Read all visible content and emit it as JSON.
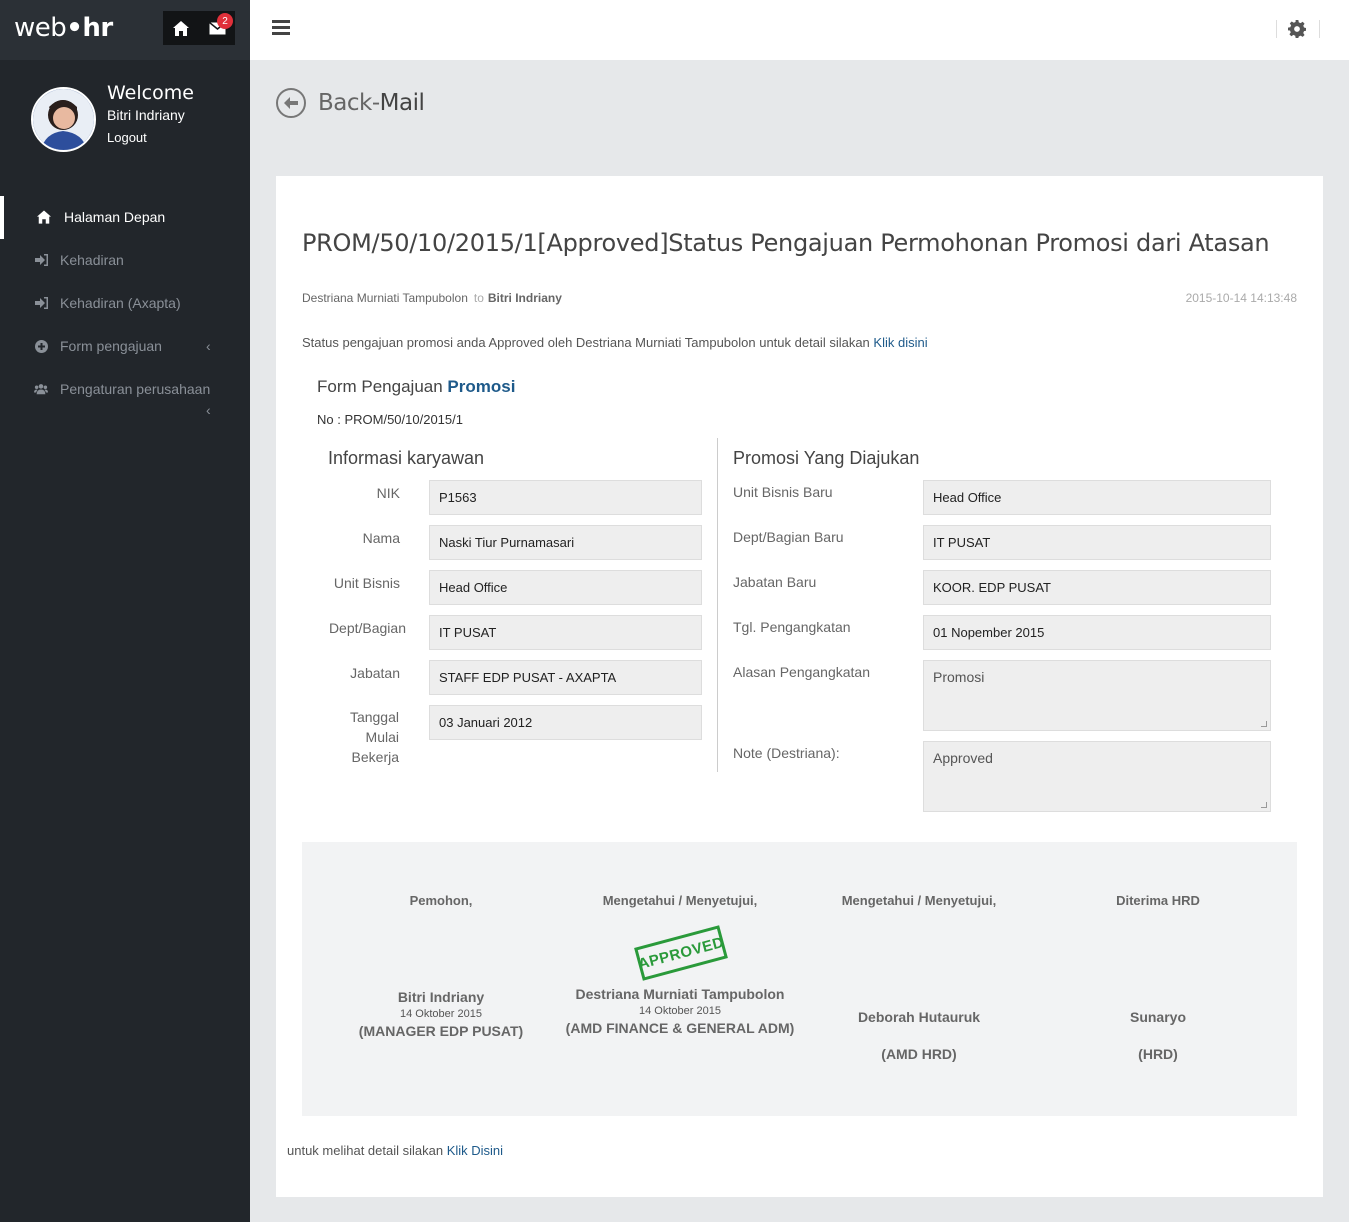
{
  "app": {
    "logo_a": "web",
    "logo_dot": "•",
    "logo_b": "hr",
    "mail_count": "2"
  },
  "profile": {
    "welcome": "Welcome",
    "name": "Bitri Indriany",
    "logout": "Logout"
  },
  "menu": {
    "items": [
      {
        "label": "Halaman Depan",
        "icon": "home-icon"
      },
      {
        "label": "Kehadiran",
        "icon": "sign-in-icon"
      },
      {
        "label": "Kehadiran (Axapta)",
        "icon": "sign-in-icon"
      },
      {
        "label": "Form pengajuan",
        "icon": "plus-circle-icon"
      },
      {
        "label": "Pengaturan perusahaan",
        "icon": "users-icon"
      }
    ]
  },
  "header": {
    "back": "Back-",
    "section": "Mail"
  },
  "mail": {
    "subject": "PROM/50/10/2015/1[Approved]Status Pengajuan Permohonan Promosi dari Atasan",
    "from": "Destriana Murniati Tampubolon",
    "to_label": "to",
    "to": "Bitri Indriany",
    "date": "2015-10-14 14:13:48",
    "message": "Status pengajuan promosi anda Approved oleh Destriana Murniati Tampubolon untuk detail silakan ",
    "message_link": "Klik disini",
    "footer": "untuk melihat detail silakan ",
    "footer_link": "Klik Disini"
  },
  "form": {
    "title": "Form Pengajuan ",
    "title_bold": "Promosi",
    "number": "No : PROM/50/10/2015/1",
    "left_title": "Informasi karyawan",
    "right_title": "Promosi Yang Diajukan",
    "left_fields": [
      {
        "label": "NIK",
        "value": "P1563"
      },
      {
        "label": "Nama",
        "value": "Naski Tiur Purnamasari"
      },
      {
        "label": "Unit Bisnis",
        "value": "Head Office"
      },
      {
        "label": "Dept/Bagian",
        "value": "IT PUSAT"
      },
      {
        "label": "Jabatan",
        "value": "STAFF EDP PUSAT - AXAPTA"
      },
      {
        "label": "Tanggal Mulai Bekerja",
        "value": "03 Januari 2012"
      }
    ],
    "tanggal_lines": [
      "Tanggal",
      "Mulai",
      "Bekerja"
    ],
    "right_fields": [
      {
        "label": "Unit Bisnis Baru",
        "value": "Head Office"
      },
      {
        "label": "Dept/Bagian Baru",
        "value": "IT PUSAT"
      },
      {
        "label": "Jabatan Baru",
        "value": "KOOR. EDP PUSAT"
      },
      {
        "label": "Tgl. Pengangkatan",
        "value": "01 Nopember 2015"
      },
      {
        "label": "Alasan Pengangkatan",
        "value": "Promosi"
      },
      {
        "label": "Note (Destriana):",
        "value": "Approved"
      }
    ]
  },
  "signatures": [
    {
      "head": "Pemohon,",
      "name": "Bitri Indriany",
      "date": "14 Oktober 2015",
      "role": "(MANAGER EDP PUSAT)"
    },
    {
      "head": "Mengetahui / Menyetujui,",
      "name": "Destriana Murniati Tampubolon",
      "date": "14 Oktober 2015",
      "role": "(AMD FINANCE & GENERAL ADM)",
      "stamp": "APPROVED"
    },
    {
      "head": "Mengetahui / Menyetujui,",
      "name": "Deborah Hutauruk",
      "role": "(AMD HRD)"
    },
    {
      "head": "Diterima HRD",
      "name": "Sunaryo",
      "role": "(HRD)"
    }
  ]
}
